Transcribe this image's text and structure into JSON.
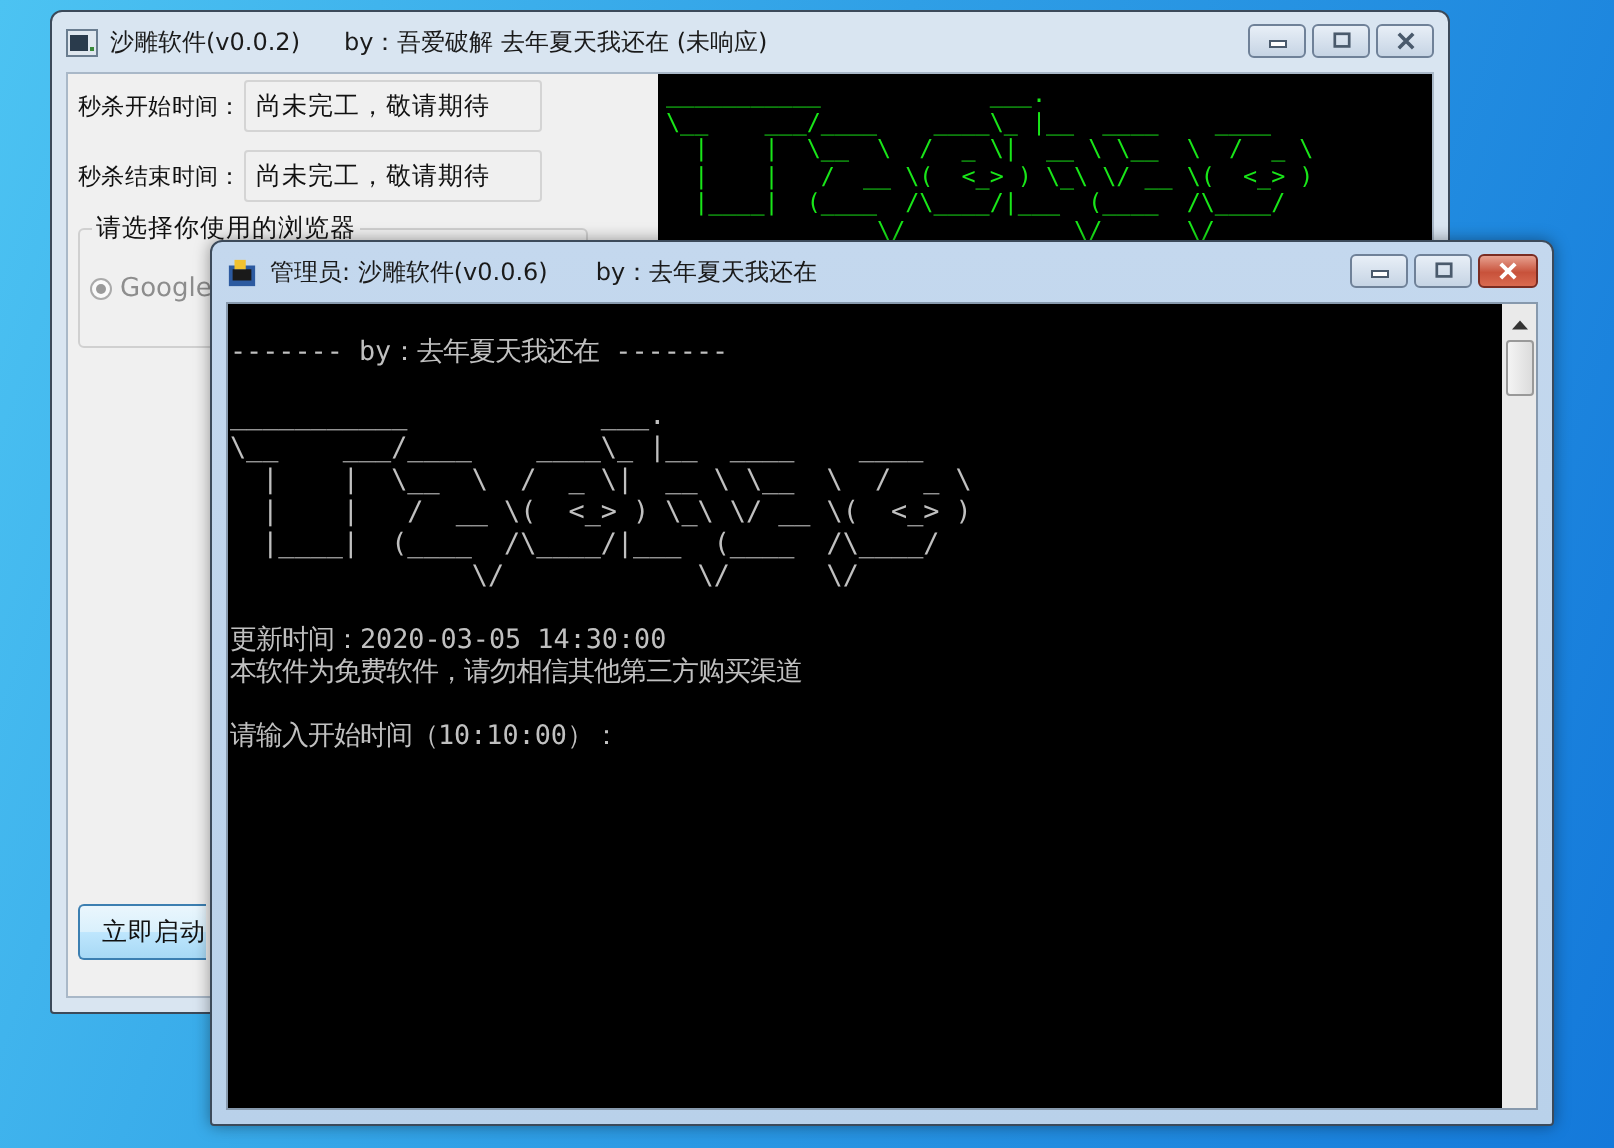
{
  "back_window": {
    "title": "沙雕软件(v0.0.2)",
    "byline": "by：吾爱破解 去年夏天我还在 (未响应)",
    "active": false,
    "fields": [
      {
        "label": "秒杀开始时间：",
        "value": "尚未完工，敬请期待"
      },
      {
        "label": "秒杀结束时间：",
        "value": "尚未完工，敬请期待"
      }
    ],
    "browser_group": {
      "title": "请选择你使用的浏览器",
      "options": [
        {
          "label": "Google",
          "selected": true,
          "disabled": true
        }
      ]
    },
    "start_button": "立即启动",
    "banner_lines": [
      "___________            ___.",
      "\\__    ___/____    ____\\_ |__  ____    ____",
      "  |    |  \\__  \\  /  _ \\|  __ \\ \\__  \\  /  _ \\",
      "  |    |   /  __ \\(  <_> ) \\_\\ \\/ __ \\(  <_> )",
      "  |____|  (____  /\\____/|___  (____  /\\____/",
      "               \\/            \\/      \\/"
    ]
  },
  "console_window": {
    "title": "管理员:  沙雕软件(v0.0.6)",
    "byline": "by：去年夏天我还在",
    "active": true,
    "blocks": [
      {
        "lines": [
          "------- by：去年夏天我还在 -------"
        ]
      },
      {
        "lines": [
          "___________            ___.",
          "\\__    ___/____    ____\\_ |__  ____    ____",
          "  |    |  \\__  \\  /  _ \\|  __ \\ \\__  \\  /  _ \\",
          "  |    |   /  __ \\(  <_> ) \\_\\ \\/ __ \\(  <_> )",
          "  |____|  (____  /\\____/|___  (____  /\\____/",
          "               \\/            \\/      \\/"
        ]
      },
      {
        "lines": [
          "更新时间：2020-03-05 14:30:00",
          "本软件为免费软件，请勿相信其他第三方购买渠道"
        ]
      },
      {
        "lines": [
          "请输入开始时间（10:10:00）："
        ]
      }
    ]
  }
}
